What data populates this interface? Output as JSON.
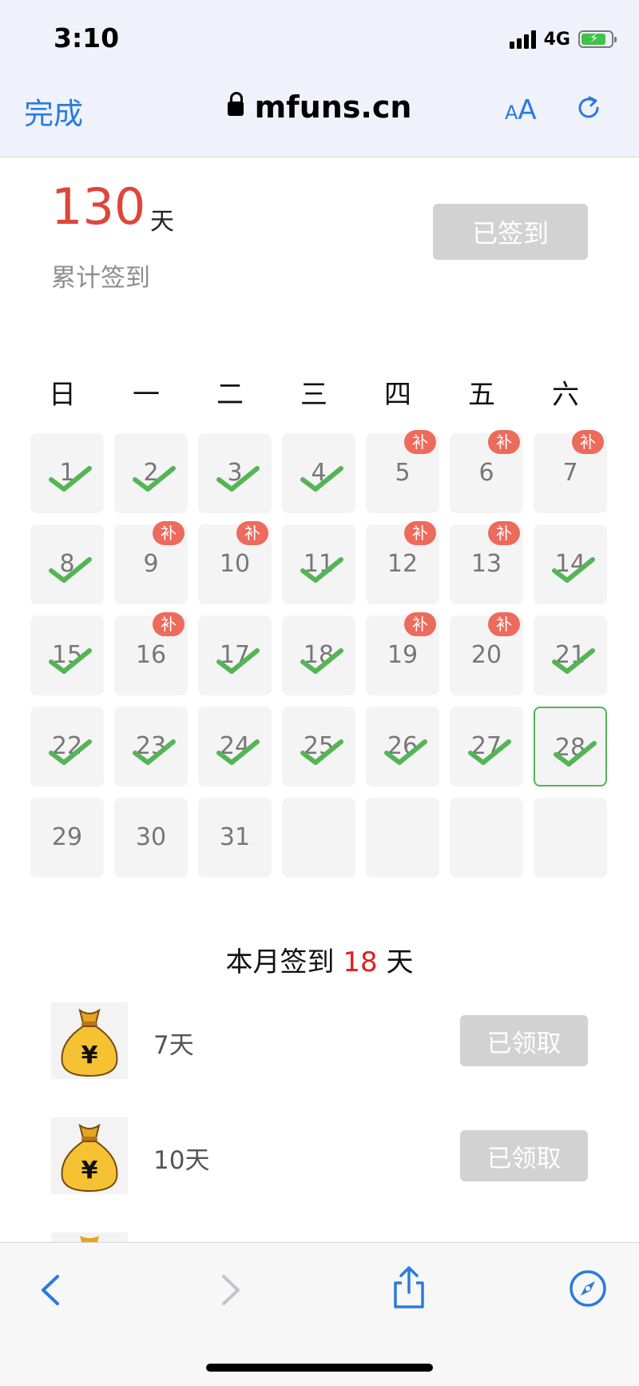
{
  "status": {
    "time": "3:10",
    "network": "4G"
  },
  "browser": {
    "done_label": "完成",
    "url": "mfuns.cn",
    "text_size": "AA"
  },
  "summary": {
    "total_days": "130",
    "unit": "天",
    "label": "累计签到",
    "signed_button": "已签到"
  },
  "calendar": {
    "weekdays": [
      "日",
      "一",
      "二",
      "三",
      "四",
      "五",
      "六"
    ],
    "days": [
      {
        "day": "1",
        "checked": true,
        "makeup": false
      },
      {
        "day": "2",
        "checked": true,
        "makeup": false
      },
      {
        "day": "3",
        "checked": true,
        "makeup": false
      },
      {
        "day": "4",
        "checked": true,
        "makeup": false
      },
      {
        "day": "5",
        "checked": false,
        "makeup": true
      },
      {
        "day": "6",
        "checked": false,
        "makeup": true
      },
      {
        "day": "7",
        "checked": false,
        "makeup": true
      },
      {
        "day": "8",
        "checked": true,
        "makeup": false
      },
      {
        "day": "9",
        "checked": false,
        "makeup": true
      },
      {
        "day": "10",
        "checked": false,
        "makeup": true
      },
      {
        "day": "11",
        "checked": true,
        "makeup": false
      },
      {
        "day": "12",
        "checked": false,
        "makeup": true
      },
      {
        "day": "13",
        "checked": false,
        "makeup": true
      },
      {
        "day": "14",
        "checked": true,
        "makeup": false
      },
      {
        "day": "15",
        "checked": true,
        "makeup": false
      },
      {
        "day": "16",
        "checked": false,
        "makeup": true
      },
      {
        "day": "17",
        "checked": true,
        "makeup": false
      },
      {
        "day": "18",
        "checked": true,
        "makeup": false
      },
      {
        "day": "19",
        "checked": false,
        "makeup": true
      },
      {
        "day": "20",
        "checked": false,
        "makeup": true
      },
      {
        "day": "21",
        "checked": true,
        "makeup": false
      },
      {
        "day": "22",
        "checked": true,
        "makeup": false
      },
      {
        "day": "23",
        "checked": true,
        "makeup": false
      },
      {
        "day": "24",
        "checked": true,
        "makeup": false
      },
      {
        "day": "25",
        "checked": true,
        "makeup": false
      },
      {
        "day": "26",
        "checked": true,
        "makeup": false
      },
      {
        "day": "27",
        "checked": true,
        "makeup": false
      },
      {
        "day": "28",
        "checked": true,
        "makeup": false,
        "today": true
      },
      {
        "day": "29",
        "checked": false,
        "makeup": false
      },
      {
        "day": "30",
        "checked": false,
        "makeup": false
      },
      {
        "day": "31",
        "checked": false,
        "makeup": false
      },
      {
        "day": "",
        "checked": false,
        "makeup": false
      },
      {
        "day": "",
        "checked": false,
        "makeup": false
      },
      {
        "day": "",
        "checked": false,
        "makeup": false
      },
      {
        "day": "",
        "checked": false,
        "makeup": false
      }
    ],
    "makeup_badge": "补"
  },
  "monthly": {
    "prefix": "本月签到",
    "count": "18",
    "suffix": "天"
  },
  "rewards": [
    {
      "label": "7天",
      "button": "已领取",
      "icon": "money-bag-icon"
    },
    {
      "label": "10天",
      "button": "已领取",
      "icon": "money-bag-icon"
    }
  ],
  "colors": {
    "accent": "#2a7bde",
    "count_red": "#e0453a",
    "check_green": "#55b456",
    "badge_red": "#ec6b5c"
  }
}
